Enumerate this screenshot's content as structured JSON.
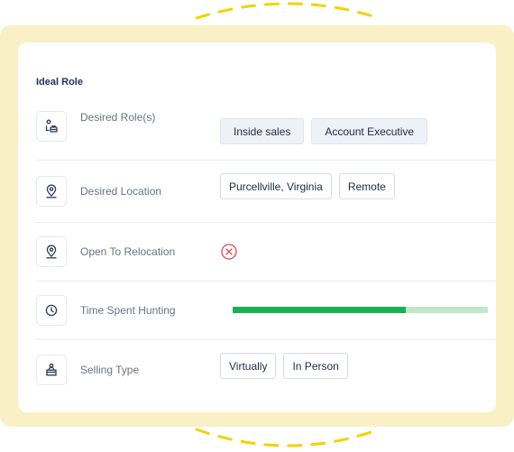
{
  "section": {
    "title": "Ideal Role"
  },
  "rows": [
    {
      "icon": "briefcase-person-icon",
      "label": "Desired Role(s)",
      "chips": [
        "Inside sales",
        "Account Executive"
      ]
    },
    {
      "icon": "location-pin-icon",
      "label": "Desired Location",
      "chips": [
        "Purcellville, Virginia",
        "Remote"
      ]
    },
    {
      "icon": "location-pin-icon",
      "label": "Open To Relocation",
      "status_icon": "x-circle-icon"
    },
    {
      "icon": "clock-icon",
      "label": "Time Spent Hunting",
      "progress": 0.68
    },
    {
      "icon": "sales-desk-icon",
      "label": "Selling Type",
      "chips": [
        "Virtually",
        "In Person"
      ]
    }
  ],
  "colors": {
    "frame": "#faf0c6",
    "dashes": "#f2d300",
    "progress_fill": "#16b251",
    "progress_track": "#bde8ca",
    "negative": "#e04a4a"
  }
}
